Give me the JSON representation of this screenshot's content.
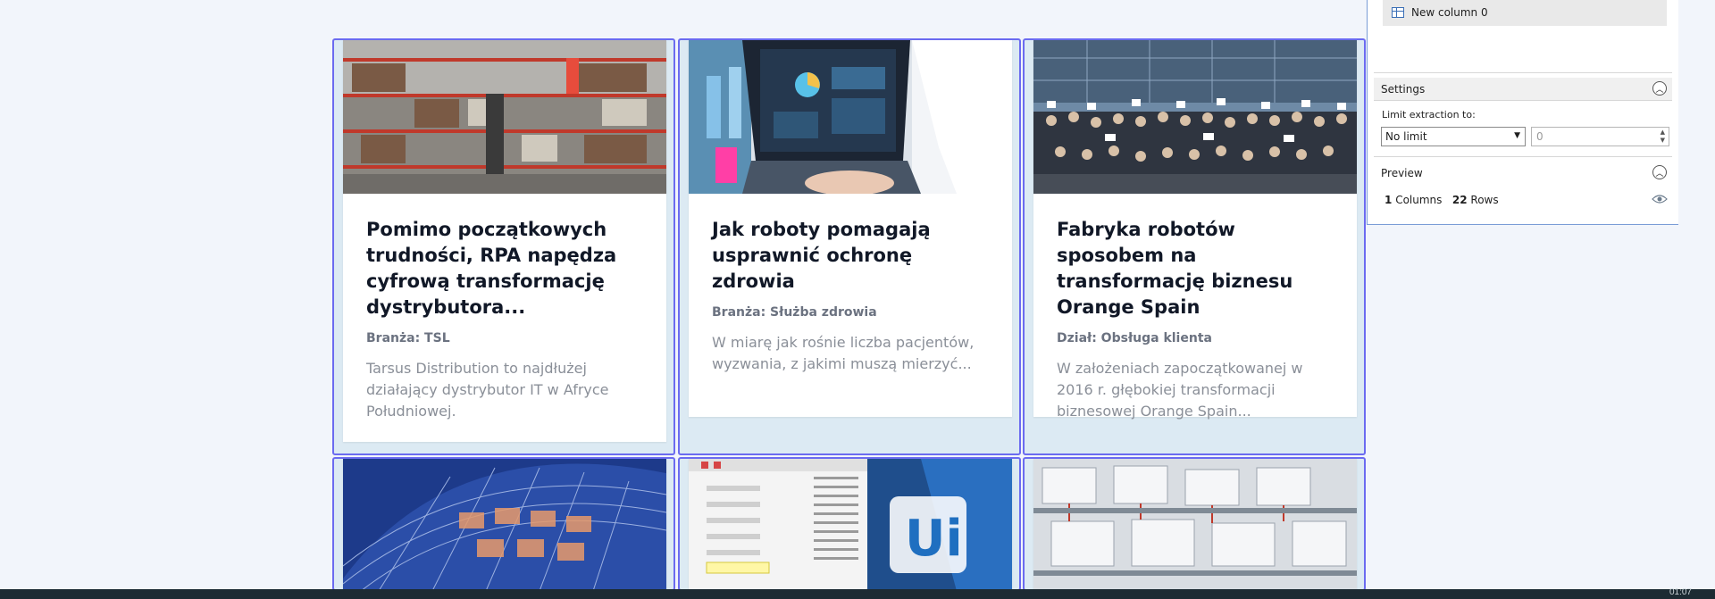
{
  "cards": [
    {
      "title": "Pomimo początkowych trudności, RPA napędza cyfrową transformację dystrybutora...",
      "category": "Branża: TSL",
      "description": "Tarsus Distribution to najdłużej działający dystrybutor IT w Afryce Południowej.",
      "image": "warehouse-image"
    },
    {
      "title": "Jak roboty pomagają usprawnić ochronę zdrowia",
      "category": "Branża: Służba zdrowia",
      "description": "W miarę jak rośnie liczba pacjentów, wyzwania, z jakimi muszą mierzyć...",
      "image": "laptop-lab-image"
    },
    {
      "title": "Fabryka robotów sposobem na transformację biznesu Orange Spain",
      "category": "Dział: Obsługa klienta",
      "description": "W założeniach zapoczątkowanej w 2016 r. głębokiej transformacji biznesowej Orange Spain...",
      "image": "group-photo-image"
    }
  ],
  "bottom_cards": [
    "building-image",
    "uipath-screenshot-image",
    "factory-line-image"
  ],
  "bottom_logo_text": "Ui",
  "panel": {
    "column_item": "New column 0",
    "settings_title": "Settings",
    "limit_label": "Limit extraction to:",
    "limit_value": "No limit",
    "limit_number_placeholder": "0",
    "preview_title": "Preview",
    "columns_count": "1",
    "columns_label": "Columns",
    "rows_count": "22",
    "rows_label": "Rows"
  },
  "taskbar": {
    "clock": "01:07"
  },
  "colors": {
    "card_border": "#6b6bf0",
    "card_bg": "#dceaf3",
    "panel_border": "#7a9cd6"
  }
}
